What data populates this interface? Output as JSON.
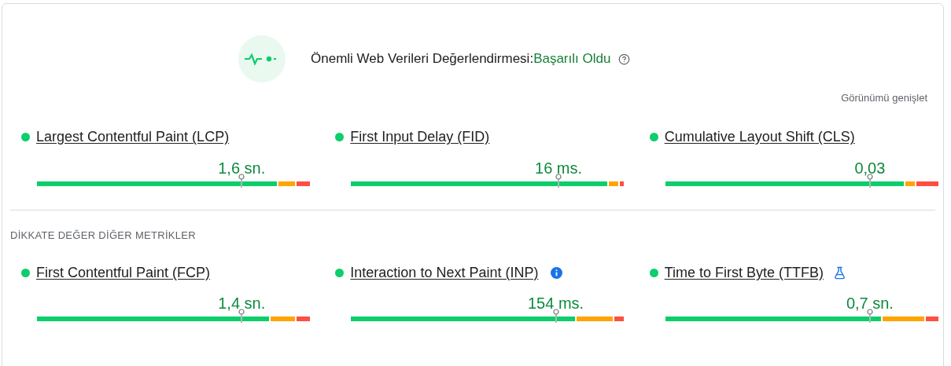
{
  "header": {
    "title": "Önemli Web Verileri Değerlendirmesi:",
    "result": "Başarılı Oldu"
  },
  "expand_link": "Görünümü genişlet",
  "core_metrics": [
    {
      "name": "Largest Contentful Paint (LCP)",
      "color": "#0cce6b",
      "value": "1,6 sn."
    },
    {
      "name": "First Input Delay (FID)",
      "color": "#0cce6b",
      "value": "16 ms."
    },
    {
      "name": "Cumulative Layout Shift (CLS)",
      "color": "#0cce6b",
      "value": "0,03"
    }
  ],
  "other_section": {
    "title": "DİKKATE DEĞER DİĞER METRİKLER"
  },
  "other_metrics": [
    {
      "name": "First Contentful Paint (FCP)",
      "color": "#0cce6b",
      "value": "1,4 sn."
    },
    {
      "name": "Interaction to Next Paint (INP)",
      "color": "#0cce6b",
      "info_icon": true,
      "value": "154 ms."
    },
    {
      "name": "Time to First Byte (TTFB)",
      "color": "#0cce6b",
      "lab_icon": true,
      "value": "0,7 sn."
    }
  ]
}
